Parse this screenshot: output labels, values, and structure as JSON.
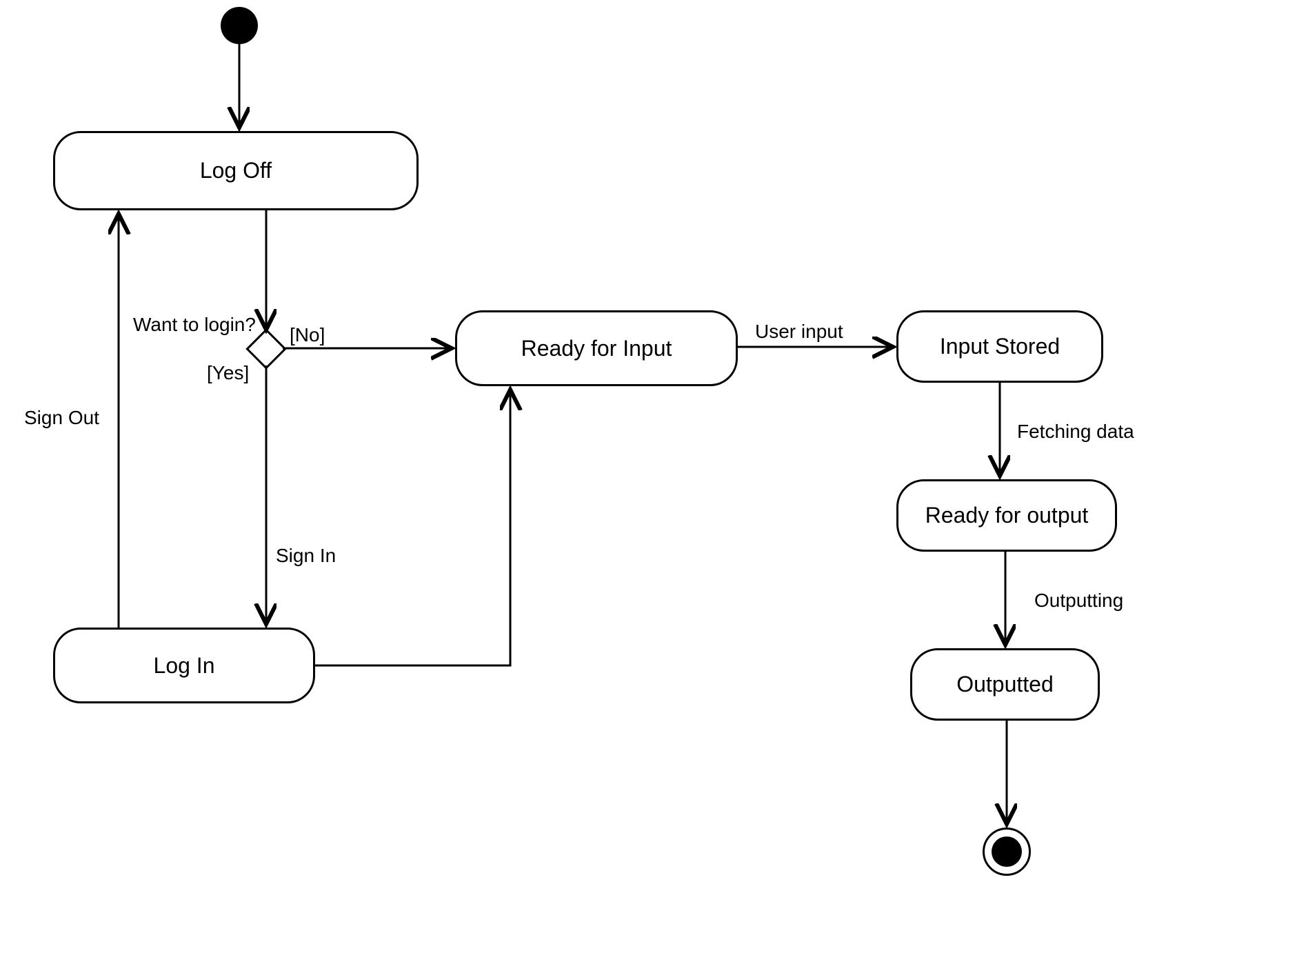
{
  "diagram": {
    "type": "uml-state-diagram",
    "initial_state": true,
    "final_state": true,
    "states": {
      "log_off": "Log Off",
      "log_in": "Log In",
      "ready_for_input": "Ready for Input",
      "input_stored": "Input Stored",
      "ready_for_output": "Ready for output",
      "outputted": "Outputted"
    },
    "decisions": {
      "want_to_login": {
        "question": "Want to login?",
        "yes": "[Yes]",
        "no": "[No]"
      }
    },
    "transitions": {
      "sign_in": "Sign In",
      "sign_out": "Sign Out",
      "user_input": "User input",
      "fetching_data": "Fetching data",
      "outputting": "Outputting"
    }
  }
}
